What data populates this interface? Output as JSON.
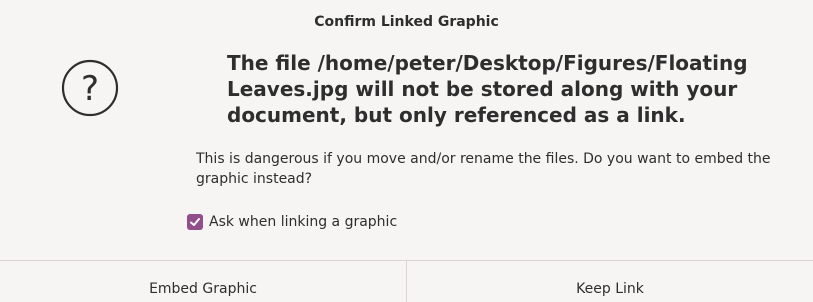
{
  "dialog": {
    "title": "Confirm Linked Graphic",
    "icon": "question-icon",
    "headline": "The file /home/peter/Desktop/Figures/Floating Leaves.jpg will not be stored along with your document, but only referenced as a link.",
    "message": "This is dangerous if you move and/or rename the files. Do you want to embed the graphic instead?",
    "checkbox": {
      "label": "Ask when linking a graphic",
      "checked": true,
      "color": "#924d8b"
    },
    "buttons": {
      "embed_label": "Embed Graphic",
      "keep_label": "Keep Link"
    }
  }
}
